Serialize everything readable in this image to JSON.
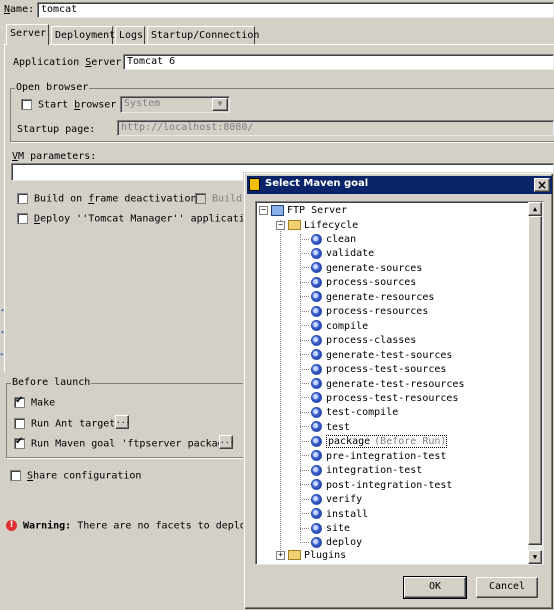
{
  "name_field": {
    "label": "Name:",
    "value": "tomcat"
  },
  "tabs": [
    {
      "label": "Server",
      "active": true
    },
    {
      "label": "Deployment",
      "active": false
    },
    {
      "label": "Logs",
      "active": false
    },
    {
      "label": "Startup/Connection",
      "active": false
    }
  ],
  "app_server": {
    "label": "Application Server:",
    "value": "Tomcat 6"
  },
  "open_browser": {
    "title": "Open browser",
    "start_browser_label": "Start browser",
    "start_browser_checked": false,
    "browser_value": "System",
    "startup_page_label": "Startup page:",
    "startup_page_value": "http://localhost:8080/"
  },
  "vm_parameters": {
    "label": "VM parameters:",
    "value": ""
  },
  "build_on_frame_label": "Build on frame deactivation",
  "build_on_frame_checked": false,
  "build_disabled_label": "Build",
  "deploy_label": "Deploy ''Tomcat Manager'' application",
  "deploy_checked": false,
  "before_launch": {
    "title": "Before launch",
    "make_label": "Make",
    "make_checked": true,
    "ant_label": "Run Ant target",
    "ant_checked": false,
    "maven_label": "Run Maven goal 'ftpserver package'",
    "maven_checked": true,
    "ellipsis": "..."
  },
  "share_label": "Share configuration",
  "share_checked": false,
  "warning": {
    "bold": "Warning:",
    "text": "There are no facets to deploy"
  },
  "dialog": {
    "title": "Select Maven goal",
    "close_glyph": "×",
    "root": "FTP Server",
    "lifecycle": "Lifecycle",
    "goals": [
      "clean",
      "validate",
      "generate-sources",
      "process-sources",
      "generate-resources",
      "process-resources",
      "compile",
      "process-classes",
      "generate-test-sources",
      "process-test-sources",
      "generate-test-resources",
      "process-test-resources",
      "test-compile",
      "test",
      "package",
      "pre-integration-test",
      "integration-test",
      "post-integration-test",
      "verify",
      "install",
      "site",
      "deploy"
    ],
    "selected_goal_suffix": "(Before Run)",
    "plugins": "Plugins",
    "ok_label": "OK",
    "cancel_label": "Cancel"
  },
  "colors": {
    "titlebar": "#0a246a",
    "face": "#d4d0c8"
  }
}
